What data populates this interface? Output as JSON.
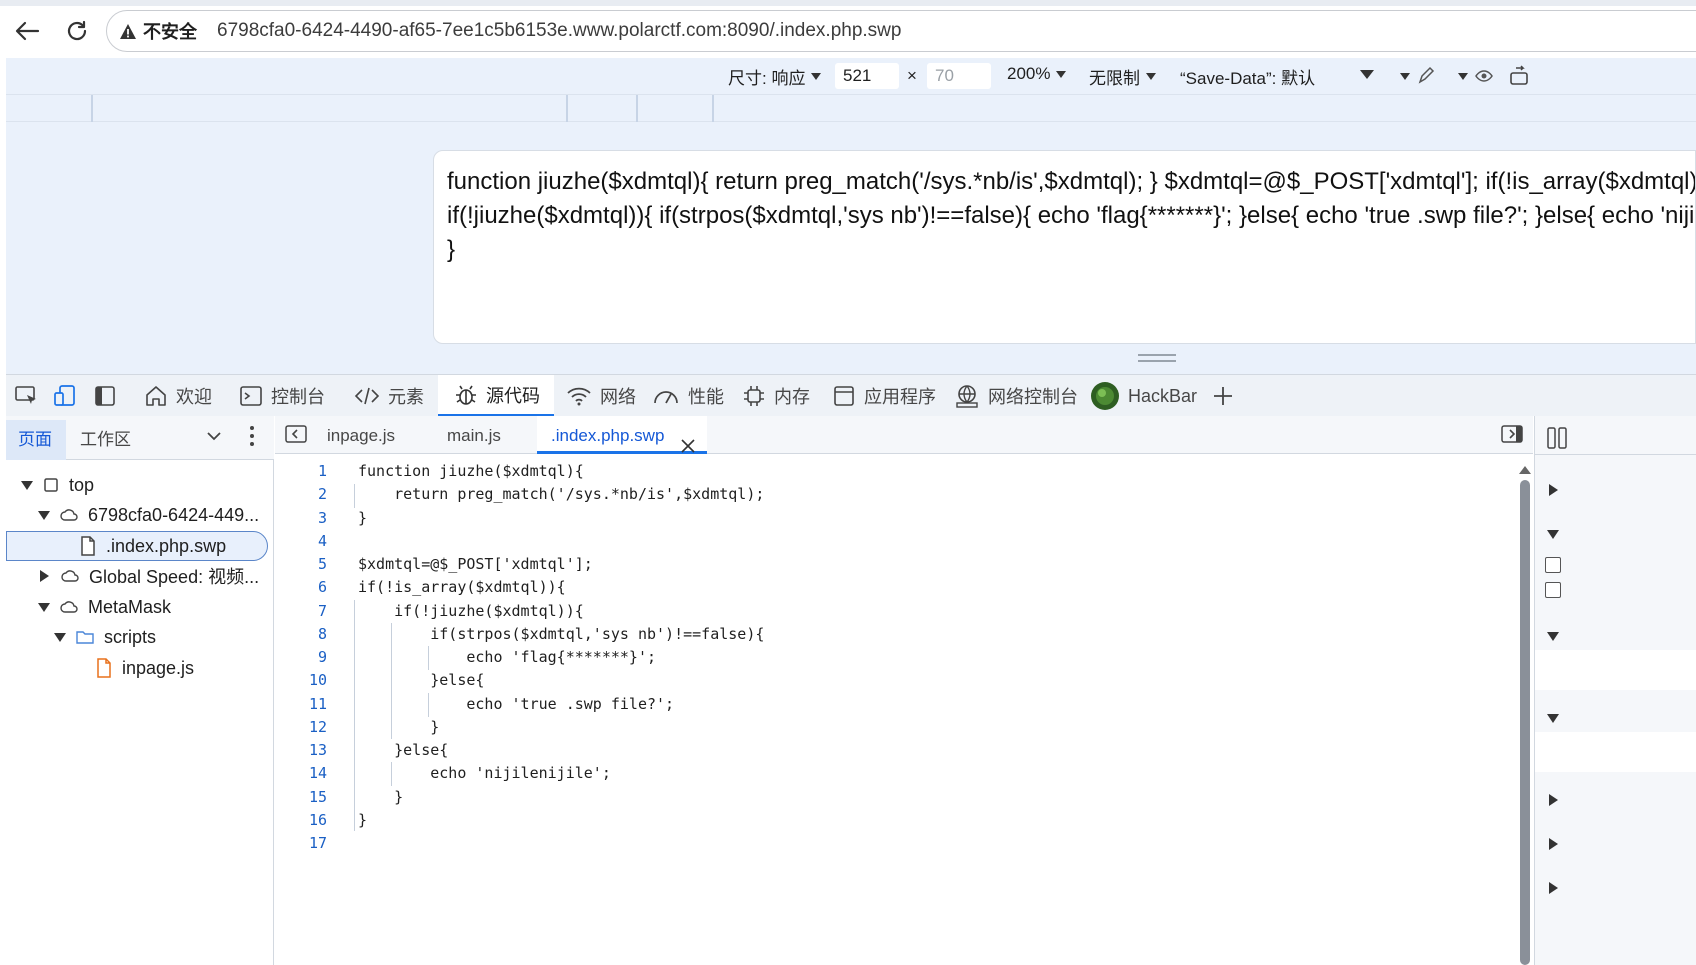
{
  "browser": {
    "insecure_label": "不安全",
    "url": "6798cfa0-6424-4490-af65-7ee1c5b6153e.www.polarctf.com:8090/.index.php.swp"
  },
  "device_toolbar": {
    "dimensions_label": "尺寸: 响应",
    "width_value": "521",
    "times": "×",
    "height_placeholder": "70",
    "zoom": "200%",
    "throttle": "无限制",
    "save_data": "“Save-Data”: 默认"
  },
  "page_content": {
    "text": "function jiuzhe($xdmtql){ return preg_match('/sys.*nb/is',$xdmtql); } $xdmtql=@$_POST['xdmtql']; if(!is_array($xdmtql)){\nif(!jiuzhe($xdmtql)){ if(strpos($xdmtql,'sys nb')!==false){ echo 'flag{*******}'; }else{ echo 'true .swp file?'; }else{ echo 'nijilenijile'; }\n}"
  },
  "devtools_tabs": [
    {
      "label": "欢迎"
    },
    {
      "label": "控制台"
    },
    {
      "label": "元素"
    },
    {
      "label": "源代码"
    },
    {
      "label": "网络"
    },
    {
      "label": "性能"
    },
    {
      "label": "内存"
    },
    {
      "label": "应用程序"
    },
    {
      "label": "网络控制台"
    },
    {
      "label": "HackBar"
    }
  ],
  "navigator": {
    "tabs": [
      {
        "label": "页面"
      },
      {
        "label": "工作区"
      }
    ],
    "tree": [
      {
        "label": "top"
      },
      {
        "label": "6798cfa0-6424-449..."
      },
      {
        "label": ".index.php.swp"
      },
      {
        "label": "Global Speed: 视频..."
      },
      {
        "label": "MetaMask"
      },
      {
        "label": "scripts"
      },
      {
        "label": "inpage.js"
      }
    ]
  },
  "editor": {
    "tabs": [
      {
        "label": "inpage.js"
      },
      {
        "label": "main.js"
      },
      {
        "label": ".index.php.swp"
      }
    ],
    "lines": [
      {
        "n": "1",
        "code": "function jiuzhe($xdmtql){"
      },
      {
        "n": "2",
        "code": "    return preg_match('/sys.*nb/is',$xdmtql);"
      },
      {
        "n": "3",
        "code": "}"
      },
      {
        "n": "4",
        "code": ""
      },
      {
        "n": "5",
        "code": "$xdmtql=@$_POST['xdmtql'];"
      },
      {
        "n": "6",
        "code": "if(!is_array($xdmtql)){"
      },
      {
        "n": "7",
        "code": "    if(!jiuzhe($xdmtql)){"
      },
      {
        "n": "8",
        "code": "        if(strpos($xdmtql,'sys nb')!==false){"
      },
      {
        "n": "9",
        "code": "            echo 'flag{*******}';"
      },
      {
        "n": "10",
        "code": "        }else{"
      },
      {
        "n": "11",
        "code": "            echo 'true .swp file?';"
      },
      {
        "n": "12",
        "code": "        }"
      },
      {
        "n": "13",
        "code": "    }else{"
      },
      {
        "n": "14",
        "code": "        echo 'nijilenijile';"
      },
      {
        "n": "15",
        "code": "    }"
      },
      {
        "n": "16",
        "code": "}"
      },
      {
        "n": "17",
        "code": ""
      }
    ]
  },
  "colors": {
    "accent": "#1a73e8",
    "line_numbers": "#1a5fc4",
    "devtools_bg": "#eef2f7",
    "viewport_bg": "#eaf1fb"
  }
}
